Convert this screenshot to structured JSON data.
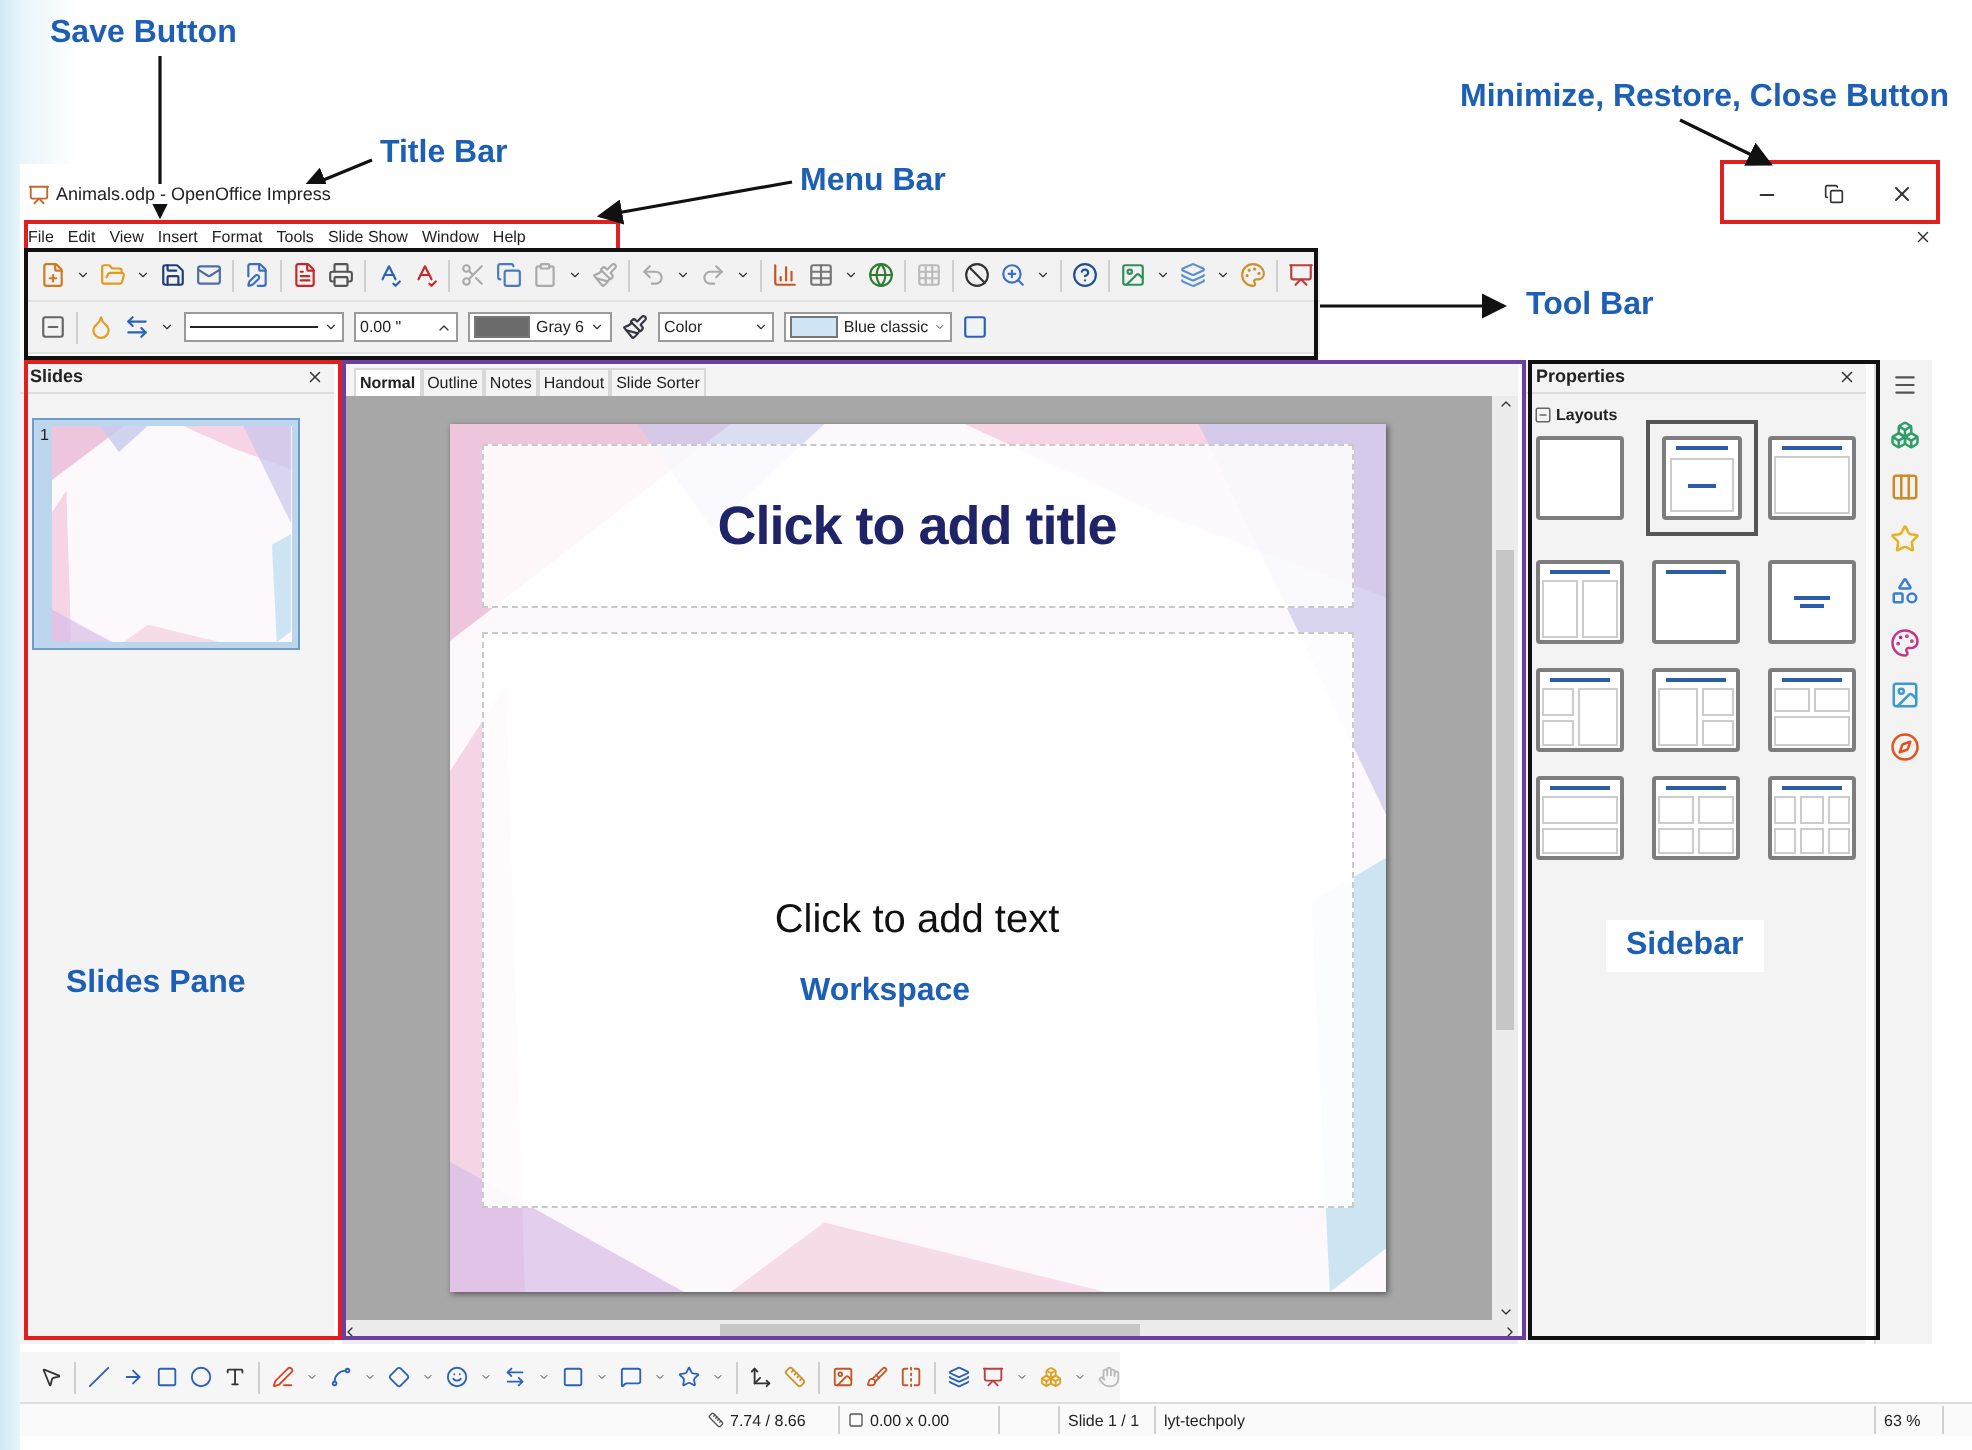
{
  "annotations": [
    {
      "kind": "save",
      "text": "Save Button"
    },
    {
      "kind": "title",
      "text": "Title Bar"
    },
    {
      "kind": "menu",
      "text": "Menu Bar"
    },
    {
      "kind": "window",
      "text": "Minimize, Restore, Close Button"
    },
    {
      "kind": "toolbar",
      "text": "Tool Bar"
    },
    {
      "kind": "slides",
      "text": "Slides Pane"
    },
    {
      "kind": "workspace",
      "text": "Workspace"
    },
    {
      "kind": "sidebar",
      "text": "Sidebar"
    }
  ],
  "window": {
    "title": "Animals.odp - OpenOffice Impress"
  },
  "menu_bar": [
    "File",
    "Edit",
    "View",
    "Insert",
    "Format",
    "Tools",
    "Slide Show",
    "Window",
    "Help"
  ],
  "line_toolbar": {
    "line_width": "0.00 \"",
    "line_color": "Gray 6",
    "area_style": "Color",
    "area_fill": "Blue classic"
  },
  "slides_pane": {
    "title": "Slides",
    "slides": [
      {
        "number": "1",
        "selected": true
      }
    ]
  },
  "view_tabs": [
    {
      "label": "Normal",
      "selected": true
    },
    {
      "label": "Outline",
      "selected": false
    },
    {
      "label": "Notes",
      "selected": false
    },
    {
      "label": "Handout",
      "selected": false
    },
    {
      "label": "Slide Sorter",
      "selected": false
    }
  ],
  "slide": {
    "title_placeholder": "Click to add title",
    "text_placeholder": "Click to add text"
  },
  "sidebar": {
    "title": "Properties",
    "section": "Layouts",
    "layouts": [
      {
        "kind": "blank",
        "selected": false
      },
      {
        "kind": "title-slide",
        "selected": true
      },
      {
        "kind": "title-content",
        "selected": false
      },
      {
        "kind": "two-columns",
        "selected": false
      },
      {
        "kind": "title-only",
        "selected": false
      },
      {
        "kind": "centered-text",
        "selected": false
      },
      {
        "kind": "left-stack",
        "selected": false
      },
      {
        "kind": "right-stack",
        "selected": false
      },
      {
        "kind": "top-pair",
        "selected": false
      },
      {
        "kind": "two-rows",
        "selected": false
      },
      {
        "kind": "four-grid",
        "selected": false
      },
      {
        "kind": "six-grid",
        "selected": false
      }
    ]
  },
  "status_bar": {
    "position": "7.74 / 8.66",
    "size": "0.00 x 0.00",
    "slide": "Slide 1 / 1",
    "master": "lyt-techpoly",
    "zoom": "63 %"
  }
}
